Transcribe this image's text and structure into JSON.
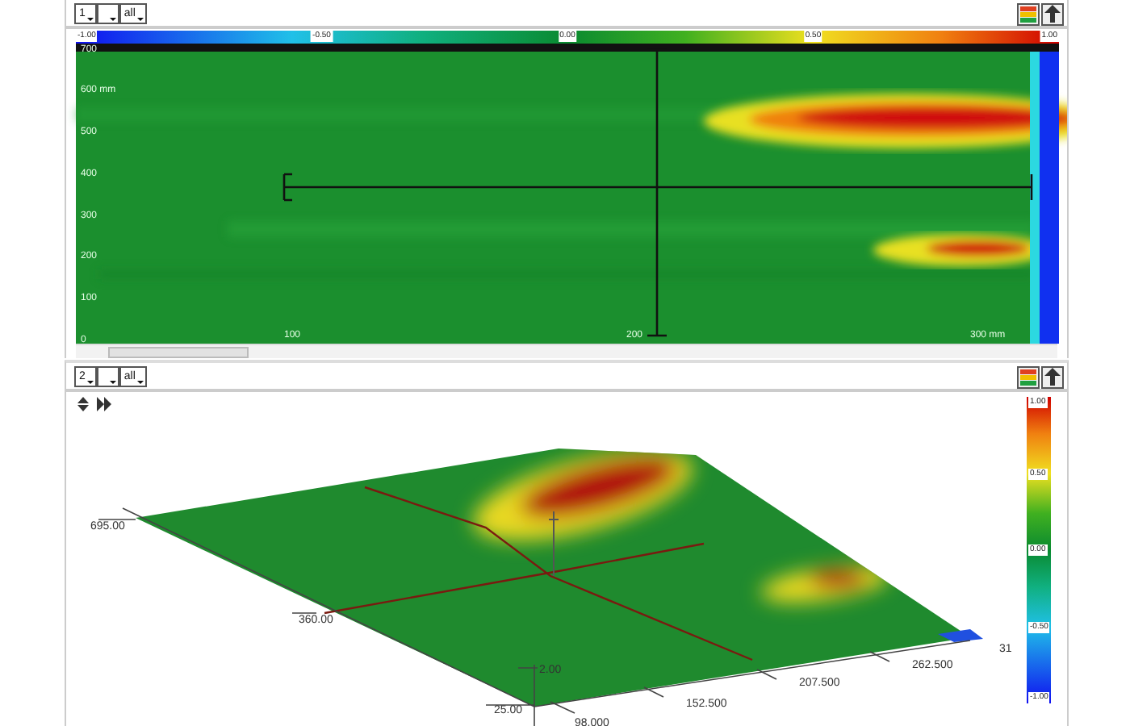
{
  "panels": [
    {
      "kind": "heatmap",
      "number": "1",
      "filter": "all",
      "colorbar_labels": [
        "-1.00",
        "-0.50",
        "0.00",
        "0.50",
        "1.00"
      ],
      "y_labels": [
        "700",
        "600 mm",
        "500",
        "400",
        "300",
        "200",
        "100",
        "0"
      ],
      "x_labels": [
        "100",
        "200",
        "300 mm"
      ]
    },
    {
      "kind": "surface",
      "number": "2",
      "filter": "all",
      "colorbar_labels": [
        "1.00",
        "0.50",
        "0.00",
        "-0.50",
        "-1.00"
      ],
      "y_labels": [
        "695.00",
        "360.00",
        "25.00"
      ],
      "x_labels": [
        "98.000",
        "152.500",
        "207.500",
        "262.500"
      ],
      "z_labels": [
        "2.00",
        "31"
      ]
    }
  ]
}
